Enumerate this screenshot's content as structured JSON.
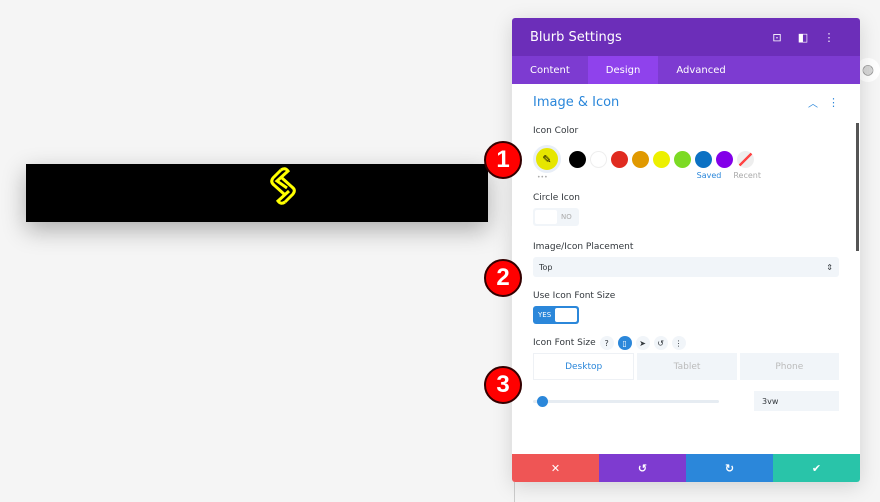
{
  "panel": {
    "title": "Blurb Settings",
    "tabs": [
      "Content",
      "Design",
      "Advanced"
    ],
    "active_tab": "Design"
  },
  "section": {
    "title": "Image & Icon"
  },
  "icon_color": {
    "label": "Icon Color",
    "selected": "#e6e600",
    "swatches": [
      "#000000",
      "#ffffff",
      "#e02b20",
      "#e09900",
      "#edf000",
      "#7cda24",
      "#0c71c3",
      "#8300e9"
    ],
    "saved": "Saved",
    "recent": "Recent",
    "more": "•••"
  },
  "circle_icon": {
    "label": "Circle Icon",
    "value": "NO"
  },
  "placement": {
    "label": "Image/Icon Placement",
    "value": "Top"
  },
  "use_font_size": {
    "label": "Use Icon Font Size",
    "value": "YES"
  },
  "font_size": {
    "label": "Icon Font Size",
    "help": "?",
    "devices": [
      "Desktop",
      "Tablet",
      "Phone"
    ],
    "active_device": "Desktop",
    "value": "3vw",
    "slider_percent": 2
  },
  "markers": [
    "1",
    "2",
    "3"
  ],
  "colors": {
    "header": "#6c2eb9",
    "accent": "#2b87da",
    "cancel": "#ef5555",
    "undo": "#7e3bd0",
    "redo": "#2b87da",
    "save": "#29c4a9"
  }
}
